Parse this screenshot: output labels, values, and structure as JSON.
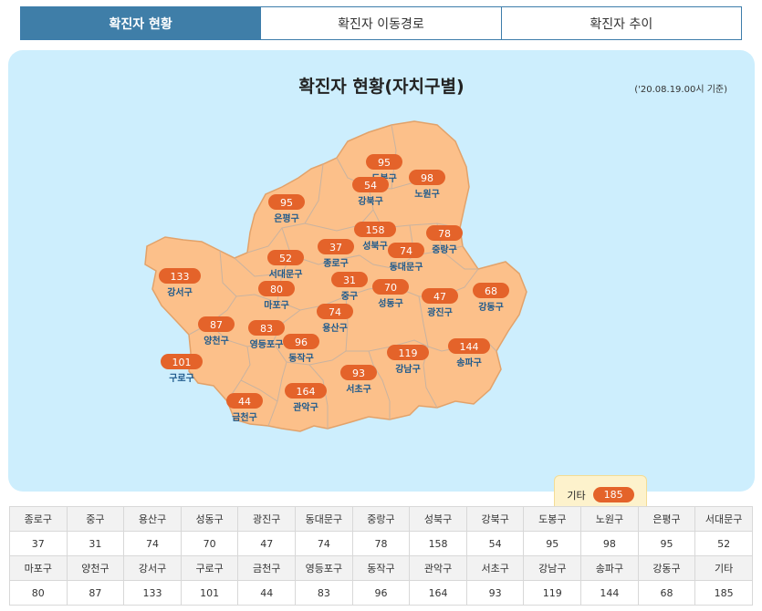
{
  "tabs": [
    {
      "label": "확진자 현황",
      "active": true
    },
    {
      "label": "확진자 이동경로",
      "active": false
    },
    {
      "label": "확진자 추이",
      "active": false
    }
  ],
  "panel": {
    "title": "확진자 현황(자치구별)",
    "date": "('20.08.19.00시 기준)"
  },
  "colors": {
    "accent": "#3f7ea8",
    "badge": "#e4632a",
    "map_fill": "#fcc08a",
    "district_label": "#1e5a8c",
    "panel_bg": "#cdeefd"
  },
  "districts": [
    {
      "name": "도봉구",
      "value": "95"
    },
    {
      "name": "노원구",
      "value": "98"
    },
    {
      "name": "강북구",
      "value": "54"
    },
    {
      "name": "은평구",
      "value": "95"
    },
    {
      "name": "성북구",
      "value": "158"
    },
    {
      "name": "중랑구",
      "value": "78"
    },
    {
      "name": "종로구",
      "value": "37"
    },
    {
      "name": "동대문구",
      "value": "74"
    },
    {
      "name": "서대문구",
      "value": "52"
    },
    {
      "name": "강서구",
      "value": "133"
    },
    {
      "name": "중구",
      "value": "31"
    },
    {
      "name": "마포구",
      "value": "80"
    },
    {
      "name": "성동구",
      "value": "70"
    },
    {
      "name": "광진구",
      "value": "47"
    },
    {
      "name": "강동구",
      "value": "68"
    },
    {
      "name": "용산구",
      "value": "74"
    },
    {
      "name": "양천구",
      "value": "87"
    },
    {
      "name": "영등포구",
      "value": "83"
    },
    {
      "name": "동작구",
      "value": "96"
    },
    {
      "name": "송파구",
      "value": "144"
    },
    {
      "name": "강남구",
      "value": "119"
    },
    {
      "name": "구로구",
      "value": "101"
    },
    {
      "name": "서초구",
      "value": "93"
    },
    {
      "name": "금천구",
      "value": "44"
    },
    {
      "name": "관악구",
      "value": "164"
    }
  ],
  "etc": {
    "label": "기타",
    "value": "185"
  },
  "table": {
    "rows": [
      {
        "headers": [
          "종로구",
          "중구",
          "용산구",
          "성동구",
          "광진구",
          "동대문구",
          "중랑구",
          "성북구",
          "강북구",
          "도봉구",
          "노원구",
          "은평구",
          "서대문구"
        ],
        "values": [
          "37",
          "31",
          "74",
          "70",
          "47",
          "74",
          "78",
          "158",
          "54",
          "95",
          "98",
          "95",
          "52"
        ]
      },
      {
        "headers": [
          "마포구",
          "양천구",
          "강서구",
          "구로구",
          "금천구",
          "영등포구",
          "동작구",
          "관악구",
          "서초구",
          "강남구",
          "송파구",
          "강동구",
          "기타"
        ],
        "values": [
          "80",
          "87",
          "133",
          "101",
          "44",
          "83",
          "96",
          "164",
          "93",
          "119",
          "144",
          "68",
          "185"
        ]
      }
    ]
  }
}
